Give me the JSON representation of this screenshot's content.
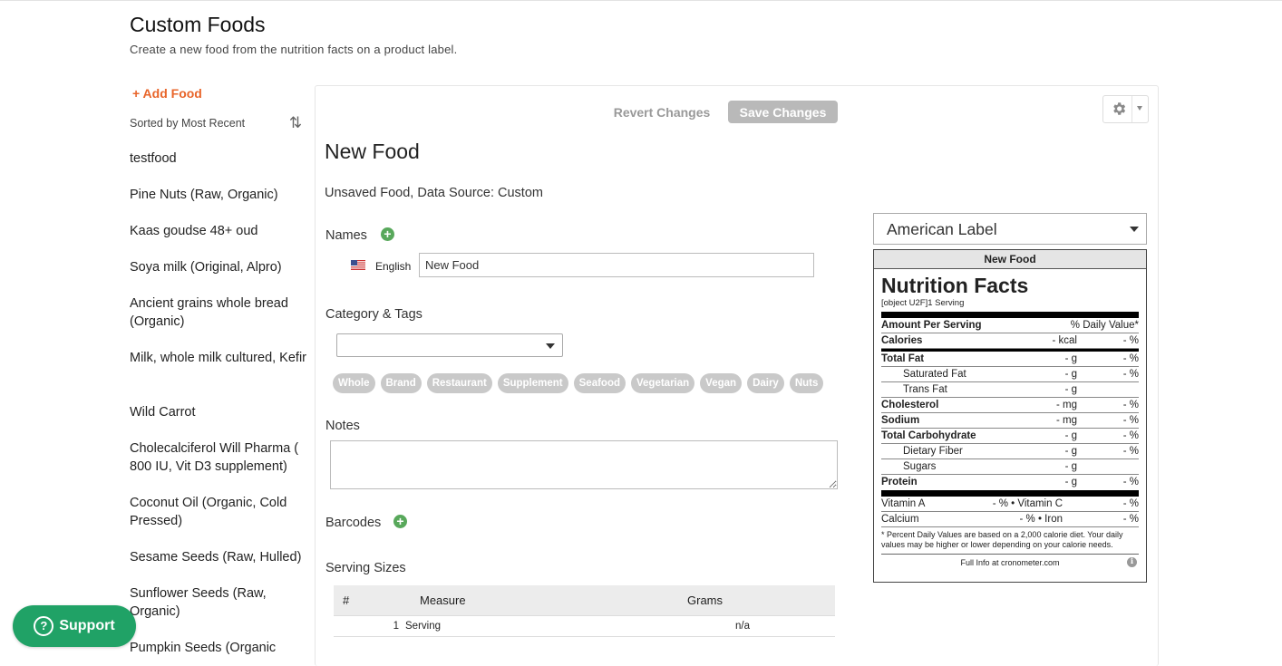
{
  "page": {
    "title": "Custom Foods",
    "subtitle": "Create a new food from the nutrition facts on a product label."
  },
  "sidebar": {
    "add_food": "+ Add Food",
    "sorted_label": "Sorted by Most Recent",
    "sort_icon": "sort-arrows-icon",
    "items": [
      "testfood",
      "Pine Nuts (Raw, Organic)",
      "Kaas goudse 48+ oud",
      "Soya milk (Original, Alpro)",
      "Ancient grains whole bread (Organic)",
      "Milk, whole milk cultured, Kefir",
      "Wild Carrot",
      "Cholecalciferol Will Pharma ( 800 IU, Vit D3 supplement)",
      "Coconut Oil (Organic, Cold Pressed)",
      "Sesame Seeds (Raw, Hulled)",
      "Sunflower Seeds (Raw, Organic)",
      "Pumpkin Seeds (Organic"
    ]
  },
  "toolbar": {
    "revert_label": "Revert Changes",
    "save_label": "Save Changes",
    "gear_icon": "gear-icon"
  },
  "editor": {
    "food_title": "New Food",
    "status": "Unsaved Food, Data Source: Custom",
    "names_label": "Names",
    "language": "English",
    "name_value": "New Food",
    "category_label": "Category & Tags",
    "category_value": "",
    "tags": [
      "Whole",
      "Brand",
      "Restaurant",
      "Supplement",
      "Seafood",
      "Vegetarian",
      "Vegan",
      "Dairy",
      "Nuts"
    ],
    "notes_label": "Notes",
    "notes_value": "",
    "barcodes_label": "Barcodes",
    "serving_label": "Serving Sizes",
    "serving_headers": [
      "#",
      "Measure",
      "Grams"
    ],
    "serving_rows": [
      {
        "num": "1",
        "measure": "Serving",
        "grams": "n/a"
      }
    ]
  },
  "label_select": {
    "value": "American Label"
  },
  "nutrition": {
    "header": "New Food",
    "title": "Nutrition Facts",
    "serving": "[object U2F]1 Serving",
    "amount_per_serving": "Amount Per Serving",
    "dv_header": "% Daily Value*",
    "rows": {
      "calories": {
        "name": "Calories",
        "amt": "- kcal",
        "dv": "- %"
      },
      "total_fat": {
        "name": "Total Fat",
        "amt": "- g",
        "dv": "- %"
      },
      "saturated_fat": {
        "name": "Saturated Fat",
        "amt": "- g",
        "dv": "- %"
      },
      "trans_fat": {
        "name": "Trans Fat",
        "amt": "- g",
        "dv": ""
      },
      "cholesterol": {
        "name": "Cholesterol",
        "amt": "- mg",
        "dv": "- %"
      },
      "sodium": {
        "name": "Sodium",
        "amt": "- mg",
        "dv": "- %"
      },
      "total_carb": {
        "name": "Total Carbohydrate",
        "amt": "- g",
        "dv": "- %"
      },
      "fiber": {
        "name": "Dietary Fiber",
        "amt": "- g",
        "dv": "- %"
      },
      "sugars": {
        "name": "Sugars",
        "amt": "- g",
        "dv": ""
      },
      "protein": {
        "name": "Protein",
        "amt": "- g",
        "dv": "- %"
      }
    },
    "vitamins": [
      {
        "n1": "Vitamin A",
        "v1": "- % • Vitamin C",
        "v2": "- %"
      },
      {
        "n1": "Calcium",
        "v1": "- % • Iron",
        "v2": "- %"
      }
    ],
    "footnote": "* Percent Daily Values are based on a 2,000 calorie diet. Your daily values may be higher or lower depending on your calorie needs.",
    "link": "Full Info at cronometer.com",
    "info_icon": "i"
  },
  "support": {
    "label": "Support",
    "icon": "?"
  },
  "colors": {
    "accent_orange": "#e8652a",
    "plus_green": "#58a85b",
    "support_green": "#20a266",
    "save_disabled": "#b9b9b9",
    "tag_gray": "#c9c9c9"
  }
}
